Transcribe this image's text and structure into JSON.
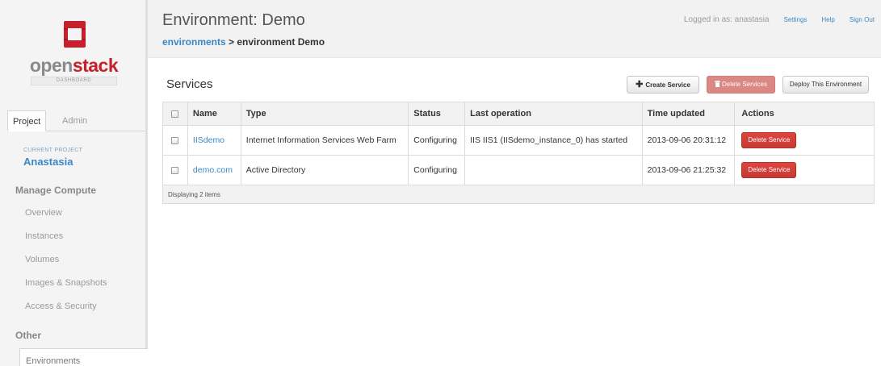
{
  "brand": {
    "logo_open": "open",
    "logo_stack": "stack",
    "logo_sub": "DASHBOARD",
    "logo_icon": "openstack-cube-icon",
    "accent": "#c8202b"
  },
  "sidebar": {
    "tabs": [
      {
        "label": "Project",
        "active": true
      },
      {
        "label": "Admin",
        "active": false
      }
    ],
    "current_project_label": "CURRENT PROJECT",
    "current_project_name": "Anastasia",
    "sections": [
      {
        "heading": "Manage Compute",
        "items": [
          {
            "label": "Overview"
          },
          {
            "label": "Instances"
          },
          {
            "label": "Volumes"
          },
          {
            "label": "Images & Snapshots"
          },
          {
            "label": "Access & Security"
          }
        ]
      },
      {
        "heading": "Other",
        "items": [
          {
            "label": "Environments",
            "active": true
          }
        ]
      }
    ]
  },
  "header": {
    "title": "Environment: Demo",
    "breadcrumb_link": "environments",
    "breadcrumb_sep": " > ",
    "breadcrumb_current": "environment Demo",
    "logged_in_text": "Logged in as: anastasia",
    "links": [
      "Settings",
      "Help",
      "Sign Out"
    ]
  },
  "services": {
    "title": "Services",
    "buttons": {
      "create": "Create Service",
      "create_icon": "plus-icon",
      "delete_all": "Delete Services",
      "delete_icon": "trash-icon",
      "deploy": "Deploy This Environment"
    },
    "columns": [
      "Name",
      "Type",
      "Status",
      "Last operation",
      "Time updated",
      "Actions"
    ],
    "rows": [
      {
        "name": "IISdemo",
        "type": "Internet Information Services Web Farm",
        "status": "Configuring",
        "last_operation": "IIS IIS1 (IISdemo_instance_0) has started",
        "time_updated": "2013-09-06 20:31:12",
        "action": "Delete Service"
      },
      {
        "name": "demo.com",
        "type": "Active Directory",
        "status": "Configuring",
        "last_operation": "",
        "time_updated": "2013-09-06 21:25:32",
        "action": "Delete Service"
      }
    ],
    "footer": "Displaying 2 items"
  },
  "colors": {
    "link": "#3b87c4",
    "danger": "#c73a35",
    "danger_disabled": "#db8784"
  }
}
